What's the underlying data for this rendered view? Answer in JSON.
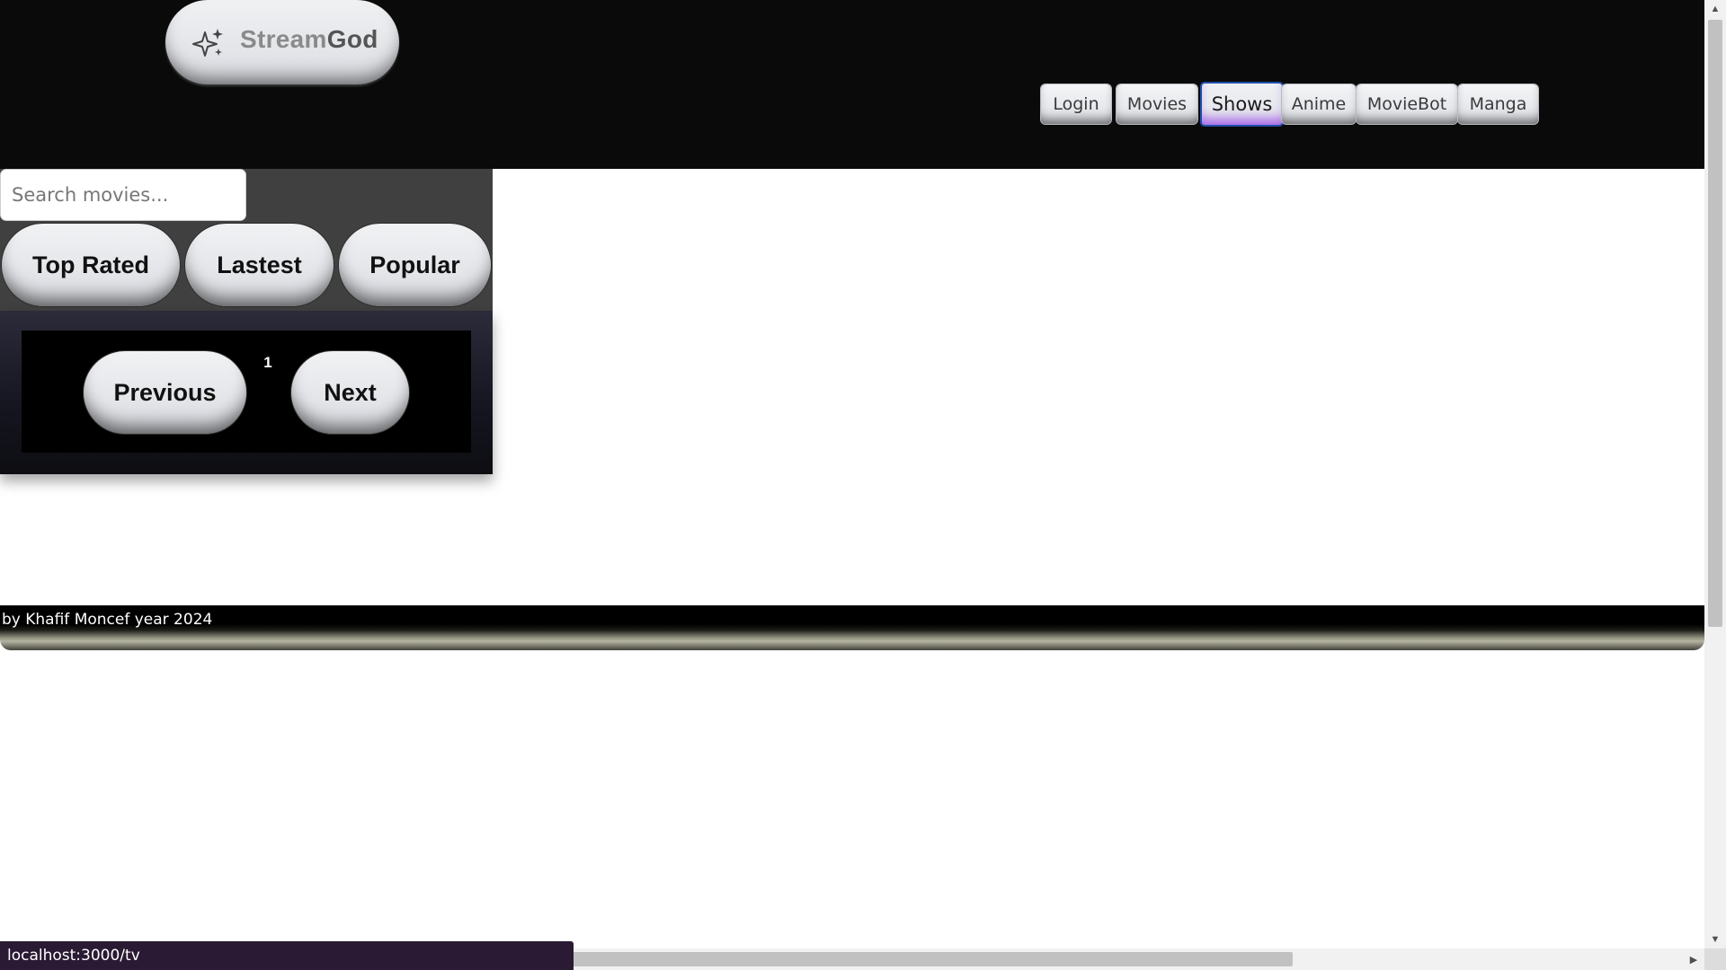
{
  "brand": {
    "name_part1": "Stream",
    "name_part2": "God",
    "icon": "sparkles-icon"
  },
  "nav": {
    "items": [
      {
        "label": "Login",
        "active": false
      },
      {
        "label": "Movies",
        "active": false
      },
      {
        "label": "Shows",
        "active": true
      },
      {
        "label": "Anime",
        "active": false
      },
      {
        "label": "MovieBot",
        "active": false
      },
      {
        "label": "Manga",
        "active": false
      }
    ]
  },
  "search": {
    "placeholder": "Search movies...",
    "value": ""
  },
  "filters": {
    "top_rated": "Top Rated",
    "latest": "Lastest",
    "popular": "Popular"
  },
  "pagination": {
    "previous": "Previous",
    "page": "1",
    "next": "Next"
  },
  "footer": {
    "text": "by Khafif Moncef year 2024"
  },
  "status_bar": {
    "url": "localhost:3000/tv"
  },
  "colors": {
    "header_bg": "#0a0a0a",
    "panel_bg": "#404040",
    "active_accent": "#1e4fa8",
    "active_glow": "#9a3ce6"
  }
}
